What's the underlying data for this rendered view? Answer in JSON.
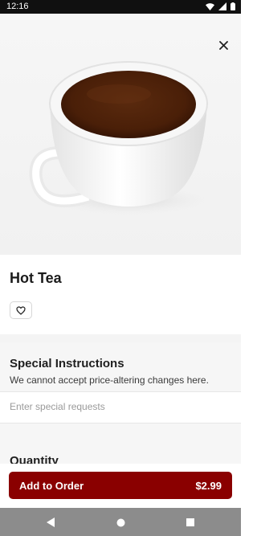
{
  "status_bar": {
    "time": "12:16",
    "icons": [
      "wifi-icon",
      "signal-icon",
      "battery-icon"
    ]
  },
  "hero": {
    "image": "hot-tea-cup-photo",
    "close_icon": "close-icon"
  },
  "item": {
    "title": "Hot Tea",
    "favorite_icon": "heart-icon"
  },
  "special_instructions": {
    "title": "Special Instructions",
    "subtitle": "We cannot accept price-altering changes here.",
    "placeholder": "Enter special requests"
  },
  "quantity": {
    "title": "Quantity"
  },
  "order_button": {
    "label": "Add to Order",
    "price": "$2.99"
  },
  "colors": {
    "accent": "#8a0000",
    "nav_bar": "#8c8c8c",
    "status_bar": "#101010"
  },
  "nav_bar": {
    "icons": [
      "back-icon",
      "home-icon",
      "recents-icon"
    ]
  }
}
